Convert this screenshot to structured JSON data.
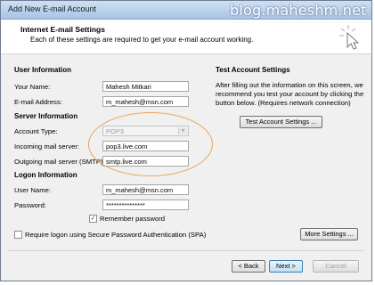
{
  "window": {
    "title": "Add New E-mail Account",
    "watermark": "blog.maheshm.net"
  },
  "header": {
    "title": "Internet E-mail Settings",
    "subtitle": "Each of these settings are required to get your e-mail account working."
  },
  "user_info": {
    "section": "User Information",
    "name_label": "Your Name:",
    "name_value": "Mahesh Mitkari",
    "email_label": "E-mail Address:",
    "email_value": "m_mahesh@msn.com"
  },
  "server_info": {
    "section": "Server Information",
    "account_type_label": "Account Type:",
    "account_type_value": "POP3",
    "incoming_label": "Incoming mail server:",
    "incoming_value": "pop3.live.com",
    "outgoing_label": "Outgoing mail server (SMTP):",
    "outgoing_value": "smtp.live.com"
  },
  "logon_info": {
    "section": "Logon Information",
    "username_label": "User Name:",
    "username_value": "m_mahesh@msn.com",
    "password_label": "Password:",
    "password_value": "***************",
    "remember_label": "Remember password",
    "remember_checked": true,
    "spa_label": "Require logon using Secure Password Authentication (SPA)",
    "spa_checked": false
  },
  "test_settings": {
    "section": "Test Account Settings",
    "desc_line1": "After filling out the information on this screen, we",
    "desc_line2": "recommend you test your account by clicking the",
    "desc_line3": "button below. (Requires network connection)",
    "button": "Test Account Settings ..."
  },
  "buttons": {
    "more_settings": "More Settings ...",
    "back": "< Back",
    "next": "Next >",
    "cancel": "Cancel"
  },
  "colors": {
    "annotation": "#f0a050",
    "titlebar": "#a9c4e6"
  },
  "icons": {
    "header_icon": "cursor-click-sparkle-icon",
    "check": "checkmark-icon"
  }
}
